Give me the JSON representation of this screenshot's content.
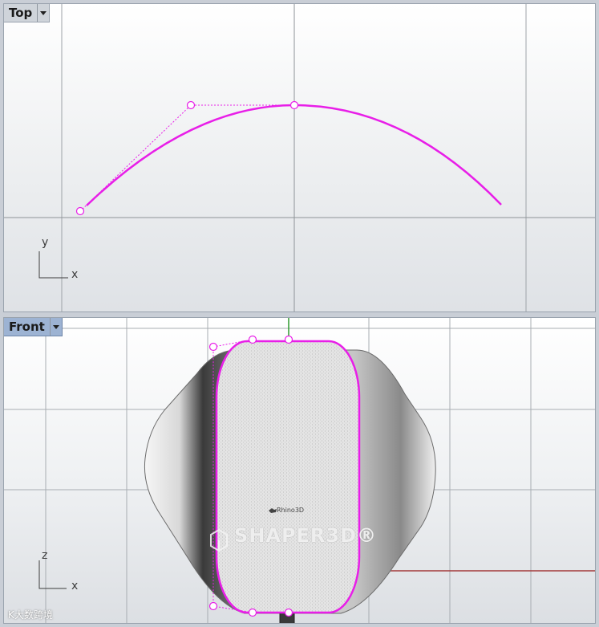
{
  "viewports": {
    "top": {
      "label": "Top",
      "axis_h": "x",
      "axis_v": "y"
    },
    "front": {
      "label": "Front",
      "axis_h": "x",
      "axis_v": "z"
    }
  },
  "watermarks": {
    "shaper": "SHAPER3D®",
    "rhino": "Rhino3D",
    "brand": "K大数跨境"
  },
  "colors": {
    "curve": "#e81ee8",
    "grid": "#9ea3a8",
    "axis_y": "#2f9a2f",
    "axis_x": "#a33a3a",
    "active_label": "#9db3d3"
  }
}
